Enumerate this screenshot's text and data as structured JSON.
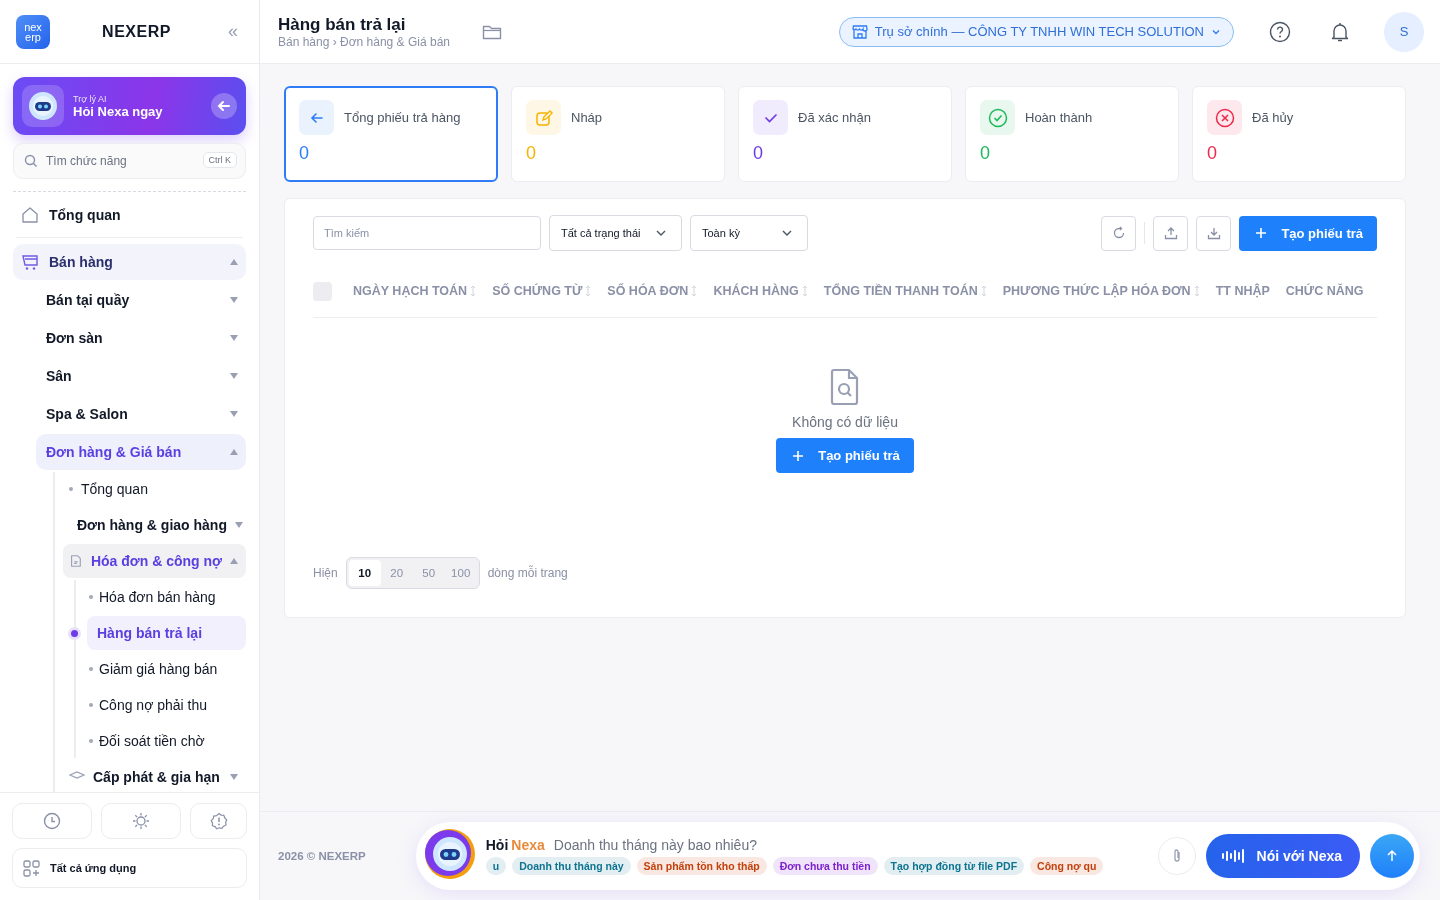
{
  "sidebar": {
    "logo": [
      "nex",
      "erp"
    ],
    "brand": "NEXERP",
    "collapse_icon": "«",
    "ai_card": {
      "subtitle": "Trợ lý AI",
      "title": "Hỏi Nexa ngay"
    },
    "search": {
      "placeholder": "Tìm chức năng",
      "shortcut": "Ctrl K"
    },
    "nav": [
      {
        "label": "Tổng quan",
        "selected": false
      },
      {
        "label": "Bán hàng",
        "selected": false,
        "expanded": true,
        "children": [
          {
            "label": "Bán tại quầy",
            "selected": false,
            "expanded": false
          },
          {
            "label": "Đơn sàn",
            "selected": false,
            "expanded": false
          },
          {
            "label": "Sân",
            "selected": false,
            "expanded": false
          },
          {
            "label": "Spa & Salon",
            "selected": false,
            "expanded": false
          },
          {
            "label": "Đơn hàng & Giá bán",
            "selected": false,
            "expanded": true,
            "children": [
              {
                "label": "Tổng quan",
                "selected": false
              },
              {
                "label": "Đơn hàng & giao hàng",
                "selected": false,
                "expanded": false
              },
              {
                "label": "Hóa đơn & công nợ",
                "selected": false,
                "expanded": true,
                "children": [
                  {
                    "label": "Hóa đơn bán hàng",
                    "selected": false
                  },
                  {
                    "label": "Hàng bán trả lại",
                    "selected": true
                  },
                  {
                    "label": "Giảm giá hàng bán",
                    "selected": false
                  },
                  {
                    "label": "Công nợ phải thu",
                    "selected": false
                  },
                  {
                    "label": "Đối soát tiền chờ",
                    "selected": false
                  }
                ]
              },
              {
                "label": "Cấp phát & gia hạn",
                "selected": false,
                "expanded": false
              }
            ]
          }
        ]
      }
    ],
    "all_apps": "Tất cả ứng dụng"
  },
  "header": {
    "title": "Hàng bán trả lại",
    "breadcrumb": "Bán hàng › Đơn hàng & Giá bán",
    "branch": "Trụ sở chính — CÔNG TY TNHH WIN TECH SOLUTION",
    "avatar": "S"
  },
  "stats": [
    {
      "label": "Tổng phiếu trả hàng",
      "value": "0",
      "color": "#2f7cf6",
      "selected": true
    },
    {
      "label": "Nháp",
      "value": "0",
      "color": "#f5b400",
      "selected": false
    },
    {
      "label": "Đã xác nhận",
      "value": "0",
      "color": "#6d3ce8",
      "selected": false
    },
    {
      "label": "Hoàn thành",
      "value": "0",
      "color": "#1fb85a",
      "selected": false
    },
    {
      "label": "Đã hủy",
      "value": "0",
      "color": "#ee2a4a",
      "selected": false
    }
  ],
  "toolbar": {
    "search_placeholder": "Tìm kiếm",
    "status": "Tất cả trạng thái",
    "period": "Toàn kỳ",
    "create": "Tạo phiếu trả"
  },
  "table": {
    "select_all": {
      "checked": false
    },
    "columns": [
      {
        "label": "NGÀY HẠCH TOÁN",
        "sortable": true
      },
      {
        "label": "SỐ CHỨNG TỪ",
        "sortable": true
      },
      {
        "label": "SỐ HÓA ĐƠN",
        "sortable": true
      },
      {
        "label": "KHÁCH HÀNG",
        "sortable": true
      },
      {
        "label": "TỔNG TIỀN THANH TOÁN",
        "sortable": true
      },
      {
        "label": "PHƯƠNG THỨC LẬP HÓA ĐƠN",
        "sortable": true
      },
      {
        "label": "TT NHẬP",
        "sortable": false
      },
      {
        "label": "CHỨC NĂNG",
        "sortable": false
      }
    ],
    "empty": {
      "message": "Không có dữ liệu",
      "button": "Tạo phiếu trả"
    }
  },
  "pagination": {
    "prefix": "Hiện",
    "options": [
      {
        "label": "10",
        "selected": true
      },
      {
        "label": "20",
        "selected": false
      },
      {
        "label": "50",
        "selected": false
      },
      {
        "label": "100",
        "selected": false
      }
    ],
    "suffix": "dòng mỗi trang"
  },
  "footer": {
    "copyright": "2026 © NEXERP",
    "ask": "Hỏi",
    "brand": "Nexa",
    "prompt": "Doanh thu tháng này bao nhiêu?",
    "chips": [
      {
        "label": "u",
        "color": "#0e7490"
      },
      {
        "label": "Doanh thu tháng này",
        "color": "#0e7490"
      },
      {
        "label": "Sản phẩm tồn kho thấp",
        "color": "#c2410c"
      },
      {
        "label": "Đơn chưa thu tiền",
        "color": "#7e22ce"
      },
      {
        "label": "Tạo hợp đồng từ file PDF",
        "color": "#0e7490"
      },
      {
        "label": "Công nợ qu",
        "color": "#c2410c"
      }
    ],
    "voice": "Nói với Nexa"
  }
}
